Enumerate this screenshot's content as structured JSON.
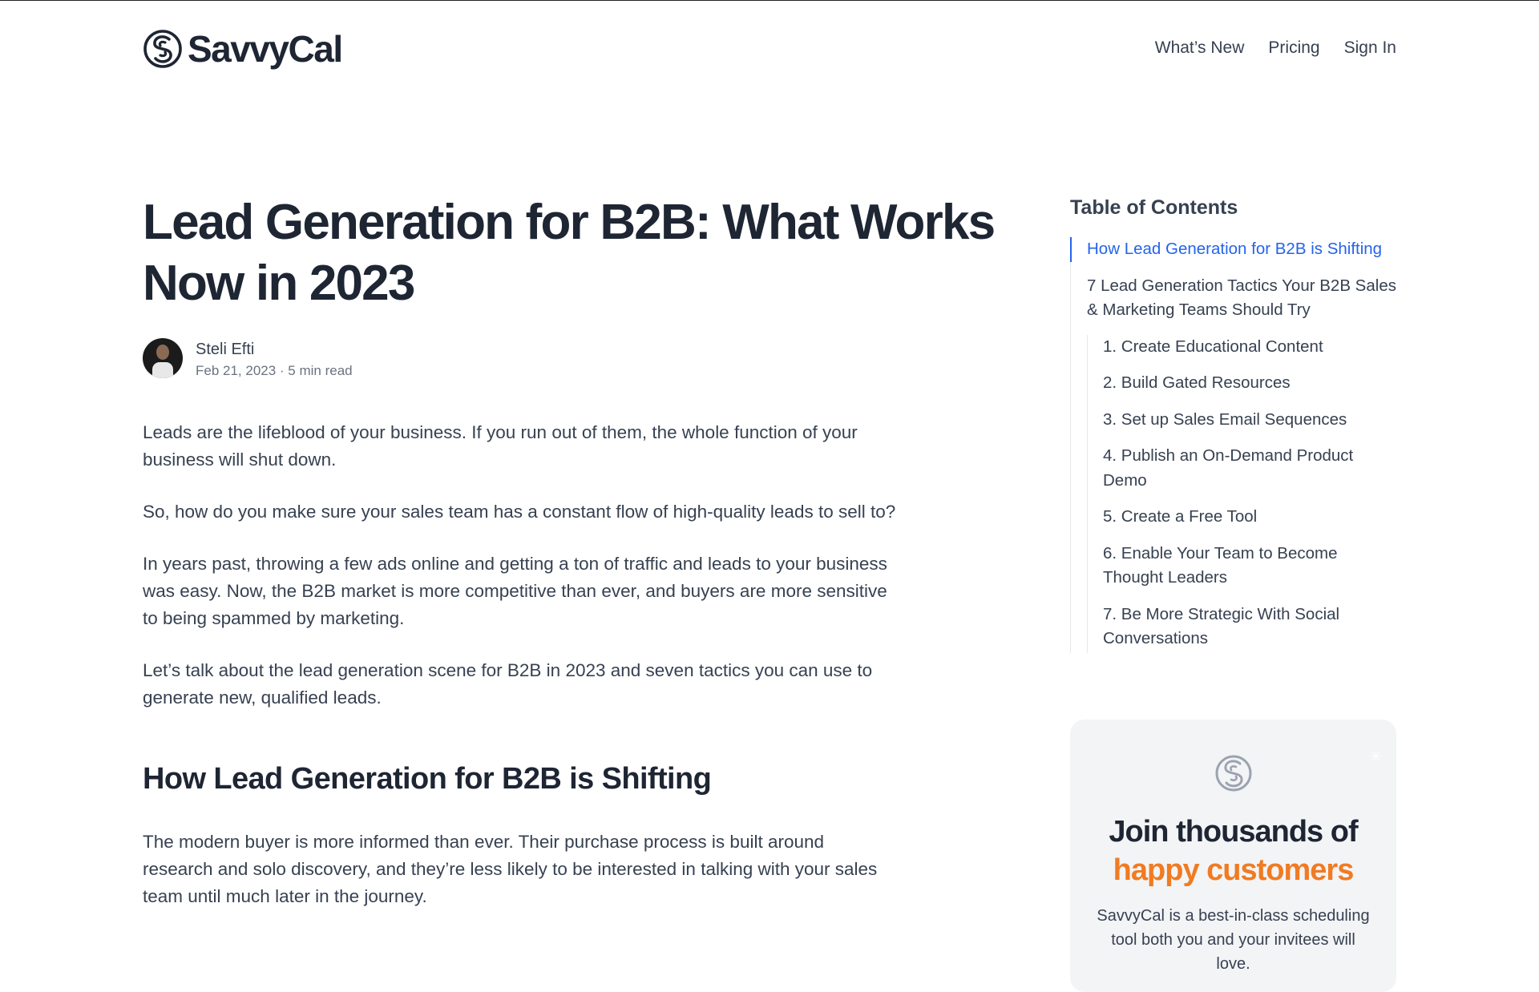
{
  "brand": {
    "name": "SavvyCal",
    "logo_icon": "savvycal-s-icon"
  },
  "nav": {
    "items": [
      "What’s New",
      "Pricing",
      "Sign In"
    ]
  },
  "article": {
    "title": "Lead Generation for B2B: What Works Now in 2023",
    "author": "Steli Efti",
    "date": "Feb 21, 2023",
    "read_time": "5 min read",
    "meta": "Feb 21, 2023 · 5 min read",
    "paragraphs": [
      "Leads are the lifeblood of your business. If you run out of them, the whole function of your business will shut down.",
      "So, how do you make sure your sales team has a constant flow of high-quality leads to sell to?",
      "In years past, throwing a few ads online and getting a ton of traffic and leads to your business was easy. Now, the B2B market is more competitive than ever, and buyers are more sensitive to being spammed by marketing.",
      "Let’s talk about the lead generation scene for B2B in 2023 and seven tactics you can use to generate new, qualified leads."
    ],
    "section_heading": "How Lead Generation for B2B is Shifting",
    "section_paragraph": "The modern buyer is more informed than ever. Their purchase process is built around research and solo discovery, and they’re less likely to be interested in talking with your sales team until much later in the journey."
  },
  "toc": {
    "title": "Table of Contents",
    "items": [
      "How Lead Generation for B2B is Shifting",
      "7 Lead Generation Tactics Your B2B Sales & Marketing Teams Should Try"
    ],
    "sub_items": [
      "1. Create Educational Content",
      "2. Build Gated Resources",
      "3. Set up Sales Email Sequences",
      "4. Publish an On-Demand Product Demo",
      "5. Create a Free Tool",
      "6. Enable Your Team to Become Thought Leaders",
      "7. Be More Strategic With Social Conversations"
    ]
  },
  "cta": {
    "heading_line1": "Join thousands of",
    "heading_line2": "happy customers",
    "subtext": "SavvyCal is a best-in-class scheduling tool both you and your invitees will love.",
    "accent_color": "#f07b22"
  },
  "colors": {
    "link_active": "#2563eb",
    "heading": "#1e2533",
    "body": "#374151"
  }
}
